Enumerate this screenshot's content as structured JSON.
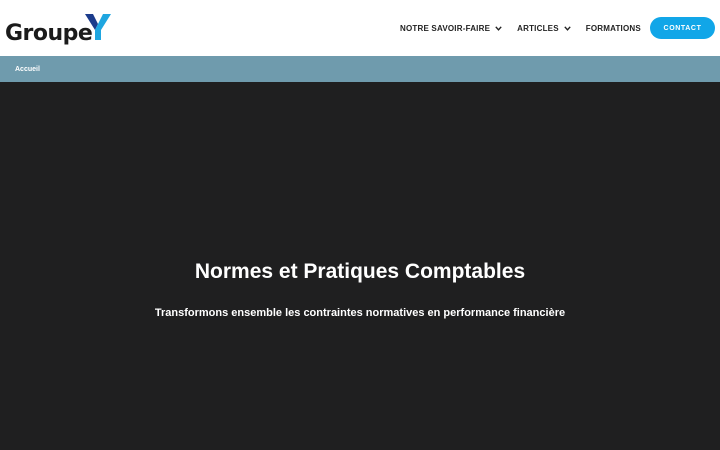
{
  "header": {
    "logo_text": "Groupe",
    "logo_letter": "Y",
    "nav": [
      {
        "label": "NOTRE SAVOIR-FAIRE",
        "has_dropdown": true
      },
      {
        "label": "ARTICLES",
        "has_dropdown": true
      },
      {
        "label": "FORMATIONS",
        "has_dropdown": false
      }
    ],
    "contact_label": "CONTACT"
  },
  "breadcrumb": {
    "items": [
      "Accueil"
    ]
  },
  "hero": {
    "title": "Normes et Pratiques Comptables",
    "subtitle": "Transformons ensemble les contraintes normatives en performance financière"
  },
  "colors": {
    "accent": "#11a6e8",
    "breadcrumb_bg": "#6f9bad",
    "hero_bg": "#1f1f20",
    "logo_y_dark": "#1b3c8c",
    "logo_y_light": "#1fa6e0"
  }
}
